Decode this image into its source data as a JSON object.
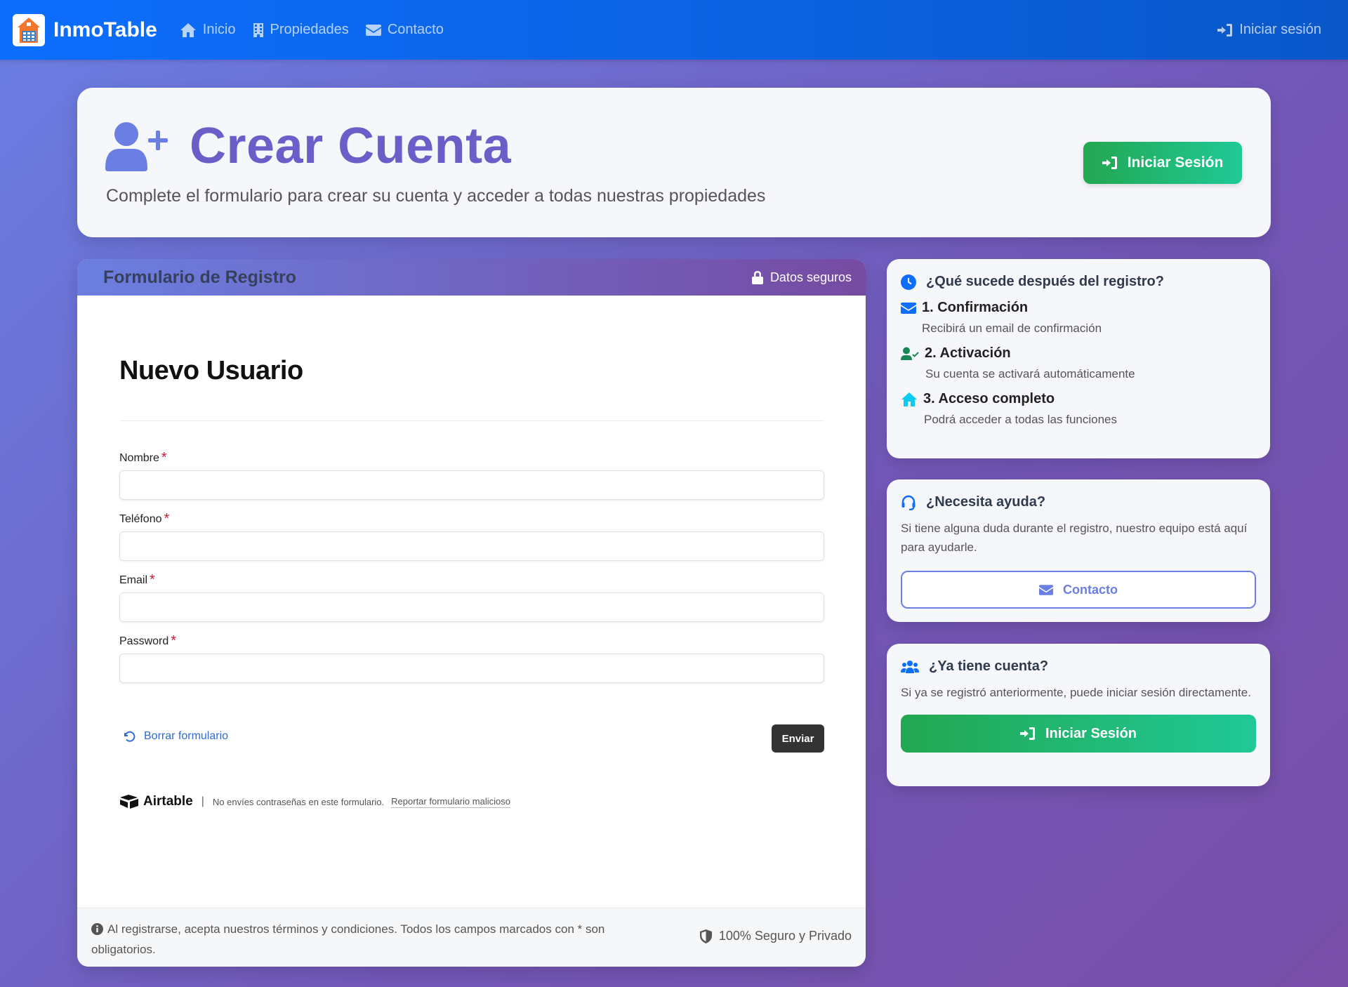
{
  "navbar": {
    "brand": "InmoTable",
    "links": [
      {
        "label": "Inicio",
        "icon": "home-icon"
      },
      {
        "label": "Propiedades",
        "icon": "building-icon"
      },
      {
        "label": "Contacto",
        "icon": "envelope-icon"
      }
    ],
    "login": "Iniciar sesión"
  },
  "header": {
    "title": "Crear Cuenta",
    "subtitle": "Complete el formulario para crear su cuenta y acceder a todas nuestras propiedades",
    "login_button": "Iniciar Sesión"
  },
  "form_card": {
    "title": "Formulario de Registro",
    "secure_badge": "Datos seguros",
    "heading": "Nuevo Usuario",
    "fields": [
      {
        "label": "Nombre",
        "required_mark": "*",
        "value": ""
      },
      {
        "label": "Teléfono",
        "required_mark": "*",
        "value": ""
      },
      {
        "label": "Email",
        "required_mark": "*",
        "value": ""
      },
      {
        "label": "Password",
        "required_mark": "*",
        "value": ""
      }
    ],
    "clear_link": "Borrar formulario",
    "submit": "Enviar",
    "airtable": {
      "brand": "Airtable",
      "separator": "|",
      "note": "No envíes contraseñas en este formulario.",
      "report": "Reportar formulario malicioso"
    },
    "footer_note": "Al registrarse, acepta nuestros términos y condiciones. Todos los campos marcados con * son obligatorios.",
    "footer_secure": "100% Seguro y Privado"
  },
  "sidebar": {
    "next_steps": {
      "title": "¿Qué sucede después del registro?",
      "steps": [
        {
          "title": "1. Confirmación",
          "desc": "Recibirá un email de confirmación",
          "icon": "envelope-icon",
          "color": "#0d6efd"
        },
        {
          "title": "2. Activación",
          "desc": "Su cuenta se activará automáticamente",
          "icon": "user-check-icon",
          "color": "#198754"
        },
        {
          "title": "3. Acceso completo",
          "desc": "Podrá acceder a todas las funciones",
          "icon": "home-icon",
          "color": "#0dcaf0"
        }
      ]
    },
    "help": {
      "title": "¿Necesita ayuda?",
      "text": "Si tiene alguna duda durante el registro, nuestro equipo está aquí para ayudarle.",
      "button": "Contacto"
    },
    "account": {
      "title": "¿Ya tiene cuenta?",
      "text": "Si ya se registró anteriormente, puede iniciar sesión directamente.",
      "button": "Iniciar Sesión"
    }
  },
  "colors": {
    "nav_bg": "#0d6efd",
    "accent_purple": "#6a5fc9",
    "green_start": "#22a751",
    "green_end": "#20c997",
    "required": "#c0203a"
  }
}
